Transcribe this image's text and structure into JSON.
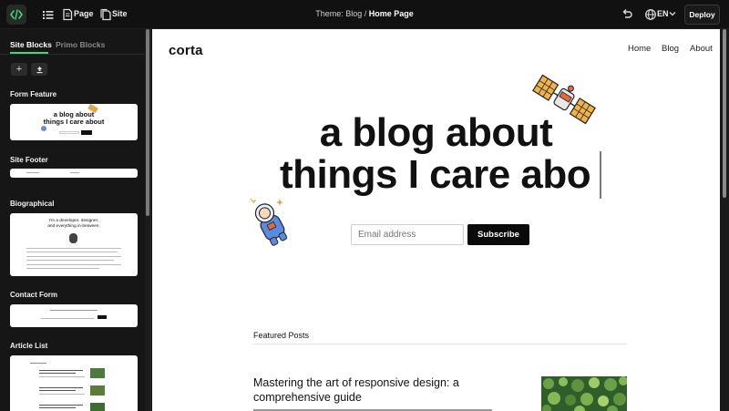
{
  "topbar": {
    "page_label": "Page",
    "site_label": "Site",
    "breadcrumb_theme": "Theme: Blog /",
    "breadcrumb_page": "Home Page",
    "language": "EN",
    "deploy_label": "Deploy",
    "icons": [
      "code-icon",
      "list-icon",
      "page-icon",
      "site-icon",
      "undo-icon",
      "globe-icon",
      "chevron-down-icon"
    ]
  },
  "sidebar": {
    "tabs": [
      {
        "label": "Site Blocks",
        "active": true
      },
      {
        "label": "Primo Blocks",
        "active": false
      }
    ],
    "action_icons": [
      "plus-icon",
      "upload-icon"
    ],
    "blocks": [
      {
        "label": "Form Feature",
        "thumb_title_1": "a blog about",
        "thumb_title_2": "things I care about"
      },
      {
        "label": "Site Footer"
      },
      {
        "label": "Biographical",
        "thumb_title_1": "I'm a developer, designer,",
        "thumb_title_2": "and everything in-between."
      },
      {
        "label": "Contact Form"
      },
      {
        "label": "Article List"
      }
    ]
  },
  "preview": {
    "site_name": "corta",
    "nav": [
      "Home",
      "Blog",
      "About"
    ],
    "hero_line_1": "a blog about",
    "hero_line_2": "things I care abo",
    "email_placeholder": "Email address",
    "subscribe_label": "Subscribe",
    "featured_heading": "Featured Posts",
    "post_title": "Mastering the art of responsive design: a comprehensive guide"
  },
  "colors": {
    "accent": "#43d27f",
    "chrome_bg": "#111111",
    "sidebar_bg": "#161616",
    "preview_bg": "#ffffff",
    "button_dark": "#0a0a0a"
  }
}
